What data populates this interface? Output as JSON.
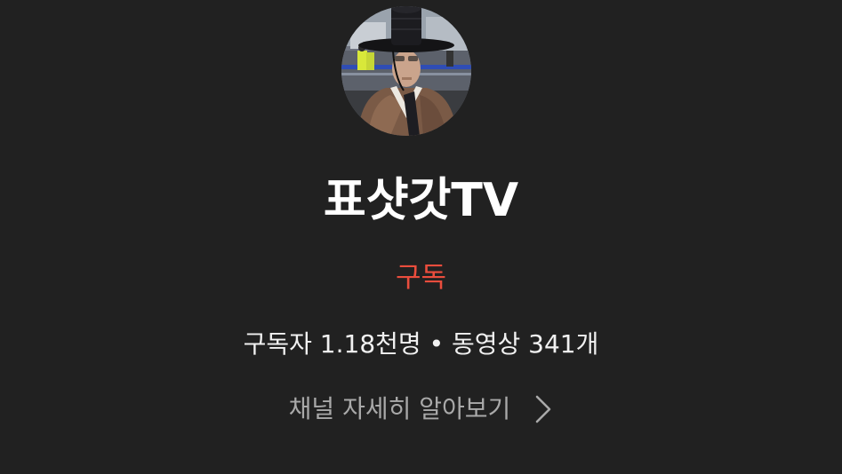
{
  "channel": {
    "name": "표샷갓TV",
    "avatar_icon": "channel-avatar-photo"
  },
  "subscribe": {
    "label": "구독",
    "color": "#ea4d3d"
  },
  "stats": {
    "text": "구독자 1.18천명 • 동영상 341개"
  },
  "details": {
    "label": "채널 자세히 알아보기",
    "icon": "chevron-right-icon"
  },
  "colors": {
    "background": "#212121",
    "primary_text": "#ffffff",
    "secondary_text": "#a9a9a9"
  }
}
